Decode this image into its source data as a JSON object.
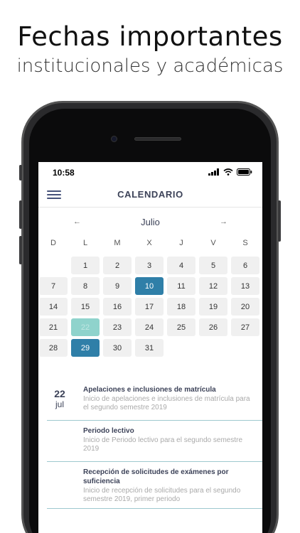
{
  "promo": {
    "headline": "Fechas importantes",
    "subline": "institucionales y académicas"
  },
  "status_bar": {
    "time": "10:58",
    "icons": [
      "signal-icon",
      "wifi-icon",
      "battery-icon"
    ]
  },
  "app": {
    "title": "CALENDARIO",
    "menu_icon": "hamburger-menu-icon"
  },
  "calendar": {
    "month": "Julio",
    "prev_arrow": "←",
    "next_arrow": "→",
    "weekdays": [
      "D",
      "L",
      "M",
      "X",
      "J",
      "V",
      "S"
    ],
    "weeks": [
      [
        "",
        "1",
        "2",
        "3",
        "4",
        "5",
        "6"
      ],
      [
        "7",
        "8",
        "9",
        "10",
        "11",
        "12",
        "13"
      ],
      [
        "14",
        "15",
        "16",
        "17",
        "18",
        "19",
        "20"
      ],
      [
        "21",
        "22",
        "23",
        "24",
        "25",
        "26",
        "27"
      ],
      [
        "28",
        "29",
        "30",
        "31",
        "",
        "",
        ""
      ]
    ],
    "selected_days": [
      "10",
      "29"
    ],
    "highlighted_day": "22",
    "colors": {
      "selected": "#2f7fa8",
      "highlighted": "#8fd3cc",
      "day_bg": "#f0f0f0",
      "title": "#3c4258",
      "divider": "#9ec8cf"
    }
  },
  "events": [
    {
      "day": "22",
      "month": "jul",
      "title": "Apelaciones e inclusiones de matrícula",
      "description": "Inicio de apelaciones e inclusiones de matrícula para el segundo semestre 2019"
    },
    {
      "day": "",
      "month": "",
      "title": "Periodo lectivo",
      "description": "Inicio de Periodo lectivo para el segundo semestre 2019"
    },
    {
      "day": "",
      "month": "",
      "title": "Recepción de solicitudes de exámenes por suficiencia",
      "description": "Inicio de recepción de solicitudes para el segundo semestre 2019, primer periodo"
    }
  ]
}
